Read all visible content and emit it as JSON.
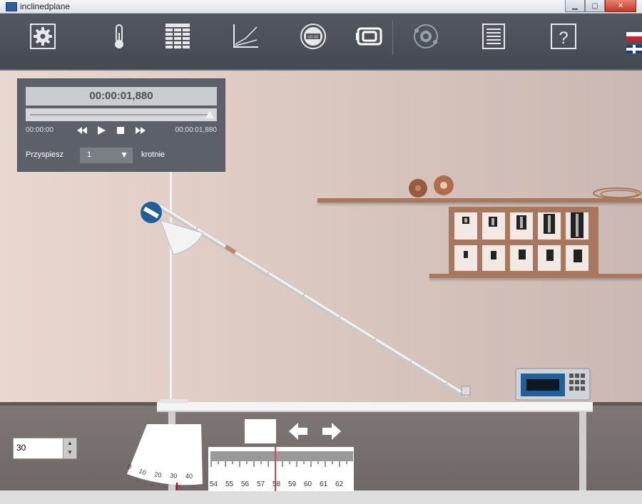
{
  "window": {
    "title": "inclinedplane",
    "controls": [
      "minimize",
      "maximize",
      "close"
    ]
  },
  "toolbar": {
    "icons": [
      {
        "name": "settings-icon"
      },
      {
        "name": "thermometer-icon"
      },
      {
        "name": "table-icon"
      },
      {
        "name": "graph-icon"
      },
      {
        "name": "stopwatch-icon"
      },
      {
        "name": "camera-icon"
      },
      {
        "name": "atom-icon"
      },
      {
        "name": "document-icon"
      },
      {
        "name": "help-icon",
        "glyph": "?"
      }
    ],
    "languages": [
      "pl",
      "en"
    ]
  },
  "player": {
    "current_time": "00:00:01,880",
    "start_time": "00:00:00",
    "end_time": "00:00:01,880",
    "progress": 1.0,
    "speed_label": "Przyspiesz",
    "speed_value": "1",
    "speed_unit": "krotnie"
  },
  "controls": {
    "angle_value": "30",
    "protractor_ticks": [
      "0",
      "10",
      "20",
      "30",
      "40"
    ],
    "ruler_ticks": [
      "54",
      "55",
      "56",
      "57",
      "58",
      "59",
      "60",
      "61",
      "62"
    ]
  },
  "colors": {
    "toolbar": "#4c5158",
    "panel": "#5c6169",
    "wall": "#dcc9c1",
    "shelf": "#a7785e",
    "accent_blue": "#1f5f9a",
    "ruler_marker": "#d0021b"
  }
}
